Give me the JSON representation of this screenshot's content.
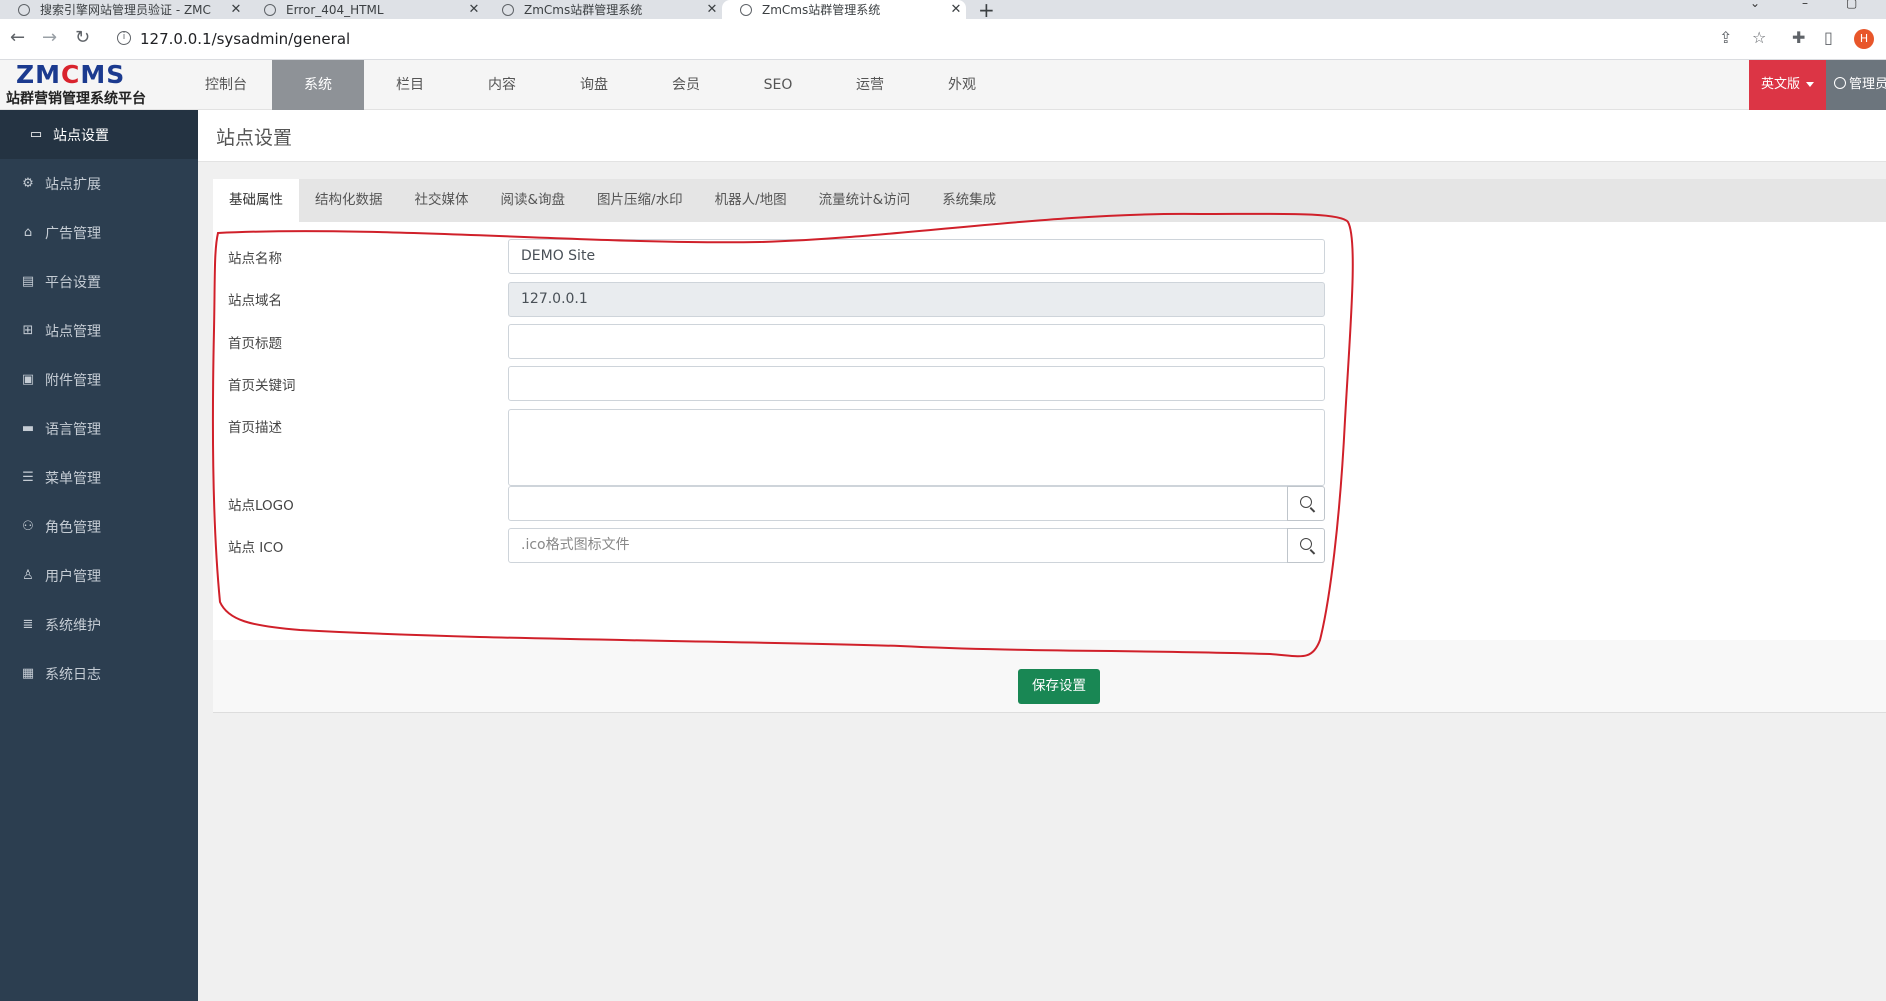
{
  "browser": {
    "tabs": [
      {
        "title": "搜索引擎网站管理员验证 - ZMC"
      },
      {
        "title": "Error_404_HTML"
      },
      {
        "title": "ZmCms站群管理系统"
      },
      {
        "title": "ZmCms站群管理系统"
      }
    ],
    "url": "127.0.0.1/sysadmin/general",
    "profile_initial": "H"
  },
  "header": {
    "logo_part1": "ZM",
    "logo_part2": "C",
    "logo_part3": "MS",
    "logo_subtitle": "站群营销管理系统平台",
    "nav": [
      "控制台",
      "系统",
      "栏目",
      "内容",
      "询盘",
      "会员",
      "SEO",
      "运营",
      "外观"
    ],
    "active_nav": "系统",
    "lang_label": "英文版",
    "admin_label": "管理员"
  },
  "sidebar": {
    "items": [
      {
        "label": "站点设置",
        "icon": "laptop-icon"
      },
      {
        "label": "站点扩展",
        "icon": "gear-icon"
      },
      {
        "label": "广告管理",
        "icon": "bag-icon"
      },
      {
        "label": "平台设置",
        "icon": "table-icon"
      },
      {
        "label": "站点管理",
        "icon": "sitemap-icon"
      },
      {
        "label": "附件管理",
        "icon": "archive-icon"
      },
      {
        "label": "语言管理",
        "icon": "translate-icon"
      },
      {
        "label": "菜单管理",
        "icon": "list-icon"
      },
      {
        "label": "角色管理",
        "icon": "people-icon"
      },
      {
        "label": "用户管理",
        "icon": "person-icon"
      },
      {
        "label": "系统维护",
        "icon": "database-icon"
      },
      {
        "label": "系统日志",
        "icon": "calendar-icon"
      }
    ]
  },
  "page": {
    "title": "站点设置",
    "tabs": [
      "基础属性",
      "结构化数据",
      "社交媒体",
      "阅读&询盘",
      "图片压缩/水印",
      "机器人/地图",
      "流量统计&访问",
      "系统集成"
    ],
    "fields": {
      "site_name_label": "站点名称",
      "site_name_value": "DEMO Site",
      "site_domain_label": "站点域名",
      "site_domain_value": "127.0.0.1",
      "home_title_label": "首页标题",
      "home_title_value": "",
      "home_keywords_label": "首页关键词",
      "home_keywords_value": "",
      "home_desc_label": "首页描述",
      "home_desc_value": "",
      "logo_label": "站点LOGO",
      "logo_value": "",
      "ico_label": "站点 ICO",
      "ico_placeholder": ".ico格式图标文件"
    },
    "save_label": "保存设置"
  },
  "colors": {
    "sidebar_bg": "#2c3e50",
    "active_nav_bg": "#8e9297",
    "lang_btn": "#dc3545",
    "save_btn": "#198754",
    "annotation": "#d0202a"
  }
}
